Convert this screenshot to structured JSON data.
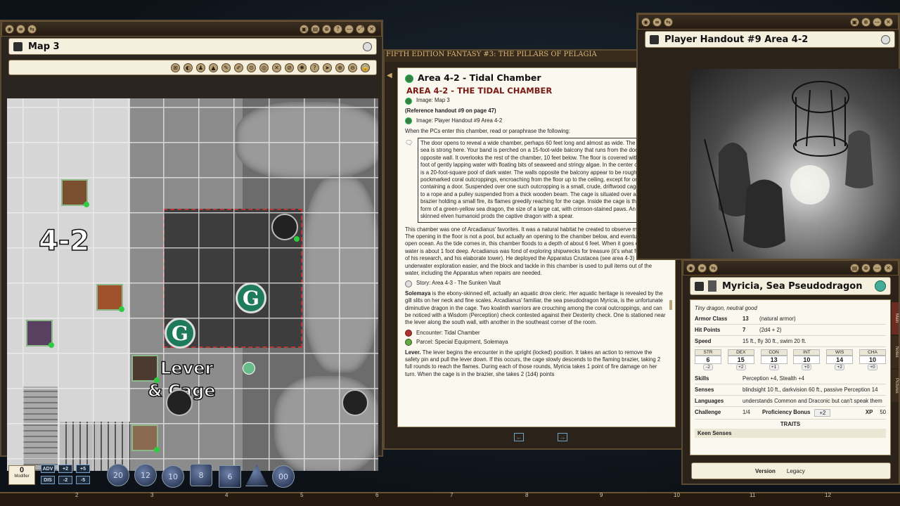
{
  "map": {
    "title": "Map 3",
    "label_area": "4-2",
    "label_lever": "Lever",
    "label_cage": "& Cage",
    "token_g": "G"
  },
  "story": {
    "banner": "FIFTH EDITION FANTASY #3: THE PILLARS OF PELAGIA",
    "title": "Area 4-2 - Tidal Chamber",
    "heading": "AREA 4-2 - THE TIDAL CHAMBER",
    "link_image_map": "Image: Map 3",
    "ref_handout": "(Reference handout #9 on page 47)",
    "link_image_handout": "Image: Player Handout #9 Area 4-2",
    "intro": "When the PCs enter this chamber, read or paraphrase the following:",
    "boxed": "The door opens to reveal a wide chamber, perhaps 60 feet long and almost as wide. The scent of the sea is strong here. Your band is perched on a 15-foot-wide balcony that runs from the door to the opposite wall. It overlooks the rest of the chamber, 10 feet below. The floor is covered with perhaps a foot of gently lapping water with floating bits of seaweed and stringy algae. In the center of the floor is a 20-foot-square pool of dark water. The walls opposite the balcony appear to be rough and pockmarked coral outcroppings, encroaching from the floor up to the ceiling, except for one section containing a door. Suspended over one such outcropping is a small, crude, driftwood cage, attached to a rope and a pulley suspended from a thick wooden beam. The cage is situated over a metal brazier holding a small fire, its flames greedily reaching for the cage. Inside the cage is the huddled form of a green-yellow sea dragon, the size of a large cat, with crimson-stained paws. An ebony-skinned elven humanoid prods the captive dragon with a spear.",
    "para1": "This chamber was one of Arcadianus' favorites. It was a natural habitat he created to observe marine life. The opening in the floor is not a pool, but actually an opening to the chamber below, and eventually to the open ocean. As the tide comes in, this chamber floods to a depth of about 6 feet. When it goes out, the water is about 1 foot deep. Arcadianus was fond of exploring shipwrecks for treasure (it's what funded most of his research, and his elaborate tower). He deployed the Apparatus Crustacea (see area 4-3) to make underwater exploration easier, and the block and tackle in this chamber is used to pull items out of the water, including the Apparatus when repairs are needed.",
    "link_story": "Story: Area 4-3 - The Sunken Vault",
    "solemaya_name": "Solemaya",
    "para2": " is the ebony-skinned elf, actually an aquatic drow cleric. Her aquatic heritage is revealed by the gill slits on her neck and fine scales. Arcadianus' familiar, the sea pseudodragon Myricia, is the unfortunate diminutive dragon in the cage. Two koalinth warriors are crouching among the coral outcroppings, and can be noticed with a Wisdom (Perception) check contested against their Dexterity check. One is stationed near the lever along the south wall, with another in the southeast corner of the room.",
    "link_encounter": "Encounter: Tidal Chamber",
    "link_parcel": "Parcel: Special Equipment, Solemaya",
    "lever_name": "Lever.",
    "para3": " The lever begins the encounter in the upright (locked) position. It takes an action to remove the safety pin and pull the lever down. If this occurs, the cage slowly descends to the flaming brazier, taking 2 full rounds to reach the flames. During each of those rounds, Myricia takes 1 point of fire damage on her turn. When the cage is in the brazier, she takes 2 (1d4) points"
  },
  "handout": {
    "title": "Player Handout #9 Area 4-2"
  },
  "creature": {
    "name": "Myricia, Sea Pseudodragon",
    "type": "Tiny dragon, neutral good",
    "armor_class_label": "Armor Class",
    "armor_class": "13",
    "armor_note": "(natural armor)",
    "hp_label": "Hit Points",
    "hp": "7",
    "hp_note": "(2d4 + 2)",
    "speed_label": "Speed",
    "speed": "15 ft., fly 30 ft., swim 20 ft.",
    "abilities": [
      {
        "name": "STR",
        "value": "6",
        "mod": "-2"
      },
      {
        "name": "DEX",
        "value": "15",
        "mod": "+2"
      },
      {
        "name": "CON",
        "value": "13",
        "mod": "+1"
      },
      {
        "name": "INT",
        "value": "10",
        "mod": "+0"
      },
      {
        "name": "WIS",
        "value": "14",
        "mod": "+2"
      },
      {
        "name": "CHA",
        "value": "10",
        "mod": "+0"
      }
    ],
    "skills_label": "Skills",
    "skills": "Perception +4, Stealth +4",
    "senses_label": "Senses",
    "senses": "blindsight 10 ft., darkvision 60 ft., passive Perception 14",
    "languages_label": "Languages",
    "languages": "understands Common and Draconic but can't speak them",
    "challenge_label": "Challenge",
    "challenge": "1/4",
    "prof_label": "Proficiency Bonus",
    "prof": "+2",
    "xp_label": "XP",
    "xp": "50",
    "traits_label": "TRAITS",
    "trait1": "Keen Senses",
    "version_label": "Version",
    "version": "Legacy",
    "tab_main": "Main",
    "tab_notes": "Notes",
    "tab_pictures": "Pictures"
  },
  "dice": {
    "modifier_value": "0",
    "modifier_label": "Modifier",
    "adv": "ADV",
    "dis": "DIS",
    "plus2": "+2",
    "plus5": "+5",
    "minus2": "-2",
    "minus5": "-5",
    "d20": "20",
    "d12": "12",
    "d10": "10",
    "d8": "8",
    "d6": "6",
    "d100": "00"
  },
  "hotkeys": [
    "2",
    "3",
    "4",
    "5",
    "6",
    "7",
    "8",
    "9",
    "10",
    "11",
    "12"
  ],
  "colors": {
    "accent": "#7a1a14",
    "frame": "#5b4a32",
    "page": "#fbf8ef"
  }
}
